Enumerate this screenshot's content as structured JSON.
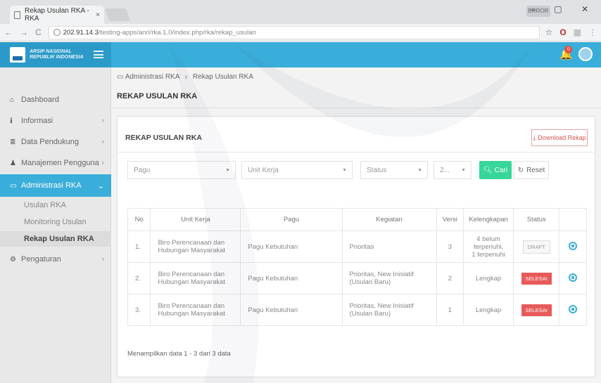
{
  "browser": {
    "tab_title": "Rekap Usulan RKA - RKA",
    "tab_close": "×",
    "url_host": "202.91.14.3",
    "url_path": "/testing-apps/anri/rka.1.0/index.php/rka/rekap_usulan",
    "window_user": "ERROR",
    "window_controls": "– ▢ ✕"
  },
  "header": {
    "logo_line1": "ARSIP NASIONAL",
    "logo_line2": "REPUBLIK INDONESIA",
    "notif_count": "0",
    "icons": [
      "menu-icon",
      "bell-icon",
      "user-avatar"
    ]
  },
  "sidebar": {
    "items": [
      {
        "label": "Dashboard",
        "icon": "home-icon"
      },
      {
        "label": "Informasi",
        "icon": "info-icon"
      },
      {
        "label": "Data Pendukung",
        "icon": "database-icon"
      },
      {
        "label": "Manajemen Pengguna",
        "icon": "user-icon"
      },
      {
        "label": "Administrasi RKA",
        "icon": "folder-icon"
      },
      {
        "label": "Pengaturan",
        "icon": "gear-icon"
      }
    ],
    "sub_items": [
      "Usulan RKA",
      "Monitoring Usulan",
      "Rekap Usulan RKA"
    ]
  },
  "breadcrumb": {
    "parent": "Administrasi RKA",
    "sep": "›",
    "current": "Rekap Usulan RKA"
  },
  "page": {
    "title": "REKAP USULAN RKA",
    "panel_title": "REKAP USULAN RKA",
    "download_label": "Download Rekap"
  },
  "filters": {
    "pagu": "Pagu",
    "unit_kerja": "Unit Kerja",
    "status": "Status",
    "year": "2...",
    "cari": "Cari",
    "reset": "Reset"
  },
  "table": {
    "headers": [
      "No",
      "Unit Kerja",
      "Pagu",
      "Kegiatan",
      "Versi",
      "Kelengkapan",
      "Status",
      ""
    ],
    "rows": [
      {
        "no": "1.",
        "unit": "Biro Perencanaan dan Hubungan Masyarakat",
        "pagu": "Pagu Kebutuhan",
        "kegiatan": "Prioritas",
        "versi": "3",
        "kelengkapan": "4 belum terpenuhi, 1 terpenuhi",
        "status": "DRAFT"
      },
      {
        "no": "2.",
        "unit": "Biro Perencanaan dan Hubungan Masyarakat",
        "pagu": "Pagu Kebutuhan",
        "kegiatan": "Prioritas, New Inisiatif (Usulan Baru)",
        "versi": "2",
        "kelengkapan": "Lengkap",
        "status": "SELESAI"
      },
      {
        "no": "3.",
        "unit": "Biro Perencanaan dan Hubungan Masyarakat",
        "pagu": "Pagu Kebutuhan",
        "kegiatan": "Prioritas, New Inisiatif (Usulan Baru)",
        "versi": "1",
        "kelengkapan": "Lengkap",
        "status": "SELESAI"
      }
    ]
  },
  "footer": {
    "summary": "Menampilkan data 1 - 3 dari 3 data"
  },
  "colors": {
    "primary": "#3aaedb",
    "success": "#37d69b",
    "danger": "#e85a5a"
  }
}
